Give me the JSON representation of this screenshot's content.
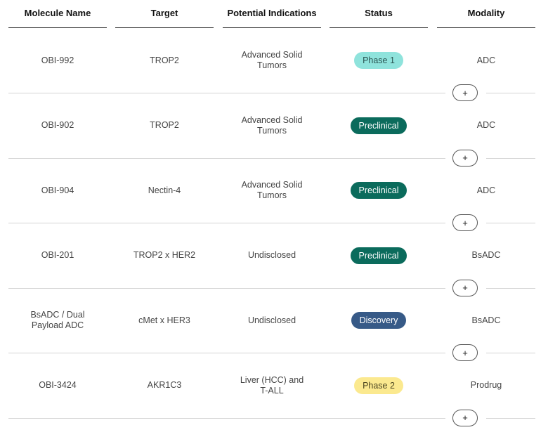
{
  "headers": {
    "molecule": "Molecule Name",
    "target": "Target",
    "indications": "Potential Indications",
    "status": "Status",
    "modality": "Modality"
  },
  "expand_label": "+",
  "status_colors": {
    "phase1": {
      "bg": "#8fe3dc",
      "fg": "#2a5552"
    },
    "preclinical": {
      "bg": "#0b6b5c",
      "fg": "#ffffff"
    },
    "discovery": {
      "bg": "#375a87",
      "fg": "#ffffff"
    },
    "phase2": {
      "bg": "#fbe98f",
      "fg": "#4a4420"
    }
  },
  "rows": [
    {
      "molecule": "OBI-992",
      "target": "TROP2",
      "indications": "Advanced Solid Tumors",
      "status": "Phase 1",
      "status_key": "phase1",
      "modality": "ADC"
    },
    {
      "molecule": "OBI-902",
      "target": "TROP2",
      "indications": "Advanced Solid Tumors",
      "status": "Preclinical",
      "status_key": "preclinical",
      "modality": "ADC"
    },
    {
      "molecule": "OBI-904",
      "target": "Nectin-4",
      "indications": "Advanced Solid Tumors",
      "status": "Preclinical",
      "status_key": "preclinical",
      "modality": "ADC"
    },
    {
      "molecule": "OBI-201",
      "target": "TROP2 x HER2",
      "indications": "Undisclosed",
      "status": "Preclinical",
      "status_key": "preclinical",
      "modality": "BsADC"
    },
    {
      "molecule": "BsADC / Dual Payload ADC",
      "target": "cMet x HER3",
      "indications": "Undisclosed",
      "status": "Discovery",
      "status_key": "discovery",
      "modality": "BsADC"
    },
    {
      "molecule": "OBI-3424",
      "target": "AKR1C3",
      "indications": "Liver (HCC) and T-ALL",
      "status": "Phase 2",
      "status_key": "phase2",
      "modality": "Prodrug"
    }
  ]
}
